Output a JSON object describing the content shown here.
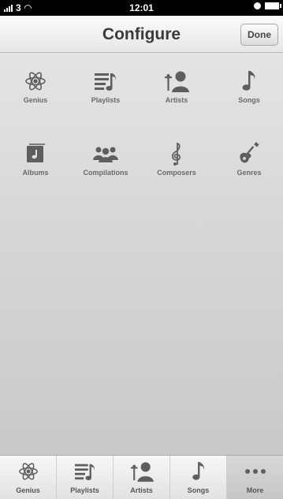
{
  "status_bar": {
    "carrier": "3",
    "time": "12:01"
  },
  "nav": {
    "title": "Configure",
    "done_label": "Done"
  },
  "grid": [
    {
      "label": "Genius",
      "icon": "genius-atom-icon"
    },
    {
      "label": "Playlists",
      "icon": "playlists-icon"
    },
    {
      "label": "Artists",
      "icon": "artists-icon"
    },
    {
      "label": "Songs",
      "icon": "songs-note-icon"
    },
    {
      "label": "Albums",
      "icon": "albums-icon"
    },
    {
      "label": "Compilations",
      "icon": "compilations-icon"
    },
    {
      "label": "Composers",
      "icon": "composers-clef-icon"
    },
    {
      "label": "Genres",
      "icon": "genres-guitar-icon"
    }
  ],
  "tabs": [
    {
      "label": "Genius",
      "icon": "genius-atom-icon"
    },
    {
      "label": "Playlists",
      "icon": "playlists-icon"
    },
    {
      "label": "Artists",
      "icon": "artists-icon"
    },
    {
      "label": "Songs",
      "icon": "songs-note-icon"
    },
    {
      "label": "More",
      "icon": "more-dots-icon",
      "selected": true
    }
  ],
  "colors": {
    "icon": "#5e5e5e",
    "label": "#6a6a6a"
  }
}
